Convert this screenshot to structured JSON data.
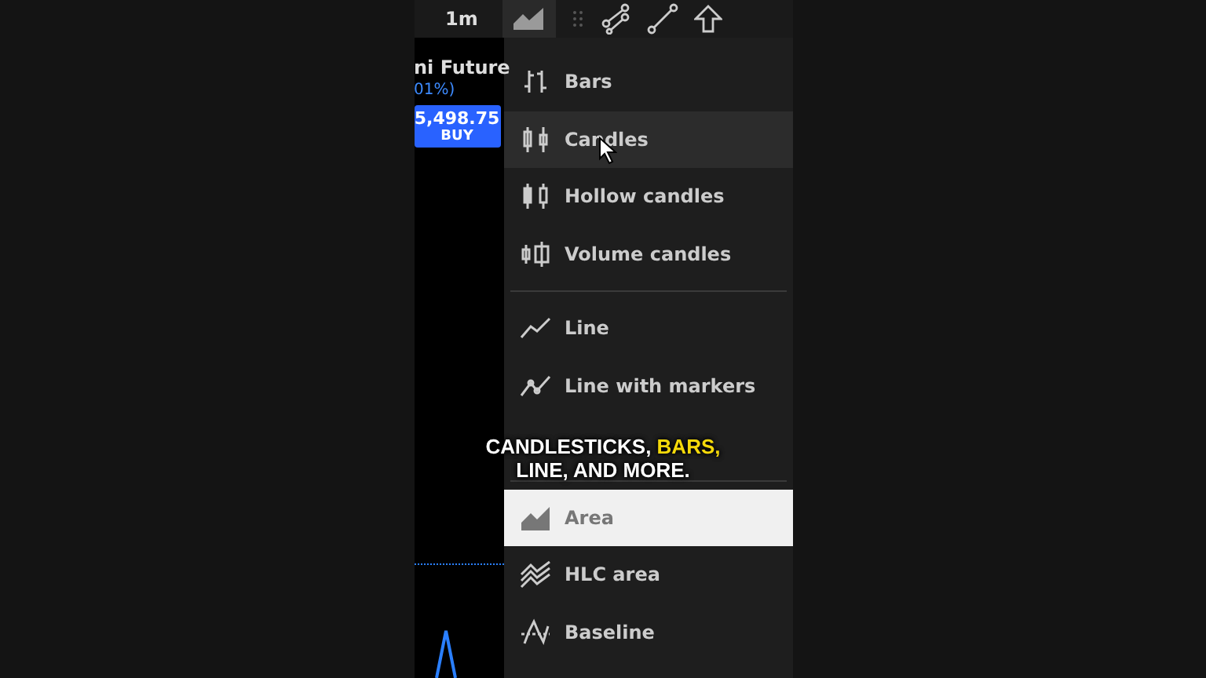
{
  "toolbar": {
    "interval": "1m"
  },
  "chart": {
    "symbol": "ni Future",
    "change": "01%)",
    "buy_price": "5,498.75",
    "buy_label": "BUY"
  },
  "menu": {
    "items": [
      {
        "kind": "bars",
        "label": "Bars",
        "selected": false,
        "hovered": false
      },
      {
        "kind": "candles",
        "label": "Candles",
        "selected": false,
        "hovered": true
      },
      {
        "kind": "hollow",
        "label": "Hollow candles",
        "selected": false,
        "hovered": false
      },
      {
        "kind": "volume",
        "label": "Volume candles",
        "selected": false,
        "hovered": false
      },
      {
        "kind": "divider"
      },
      {
        "kind": "line",
        "label": "Line",
        "selected": false,
        "hovered": false
      },
      {
        "kind": "markers",
        "label": "Line with markers",
        "selected": false,
        "hovered": false
      },
      {
        "kind": "step"
      },
      {
        "kind": "divider"
      },
      {
        "kind": "area",
        "label": "Area",
        "selected": true,
        "hovered": false
      },
      {
        "kind": "hlc",
        "label": "HLC area",
        "selected": false,
        "hovered": false
      },
      {
        "kind": "baseline",
        "label": "Baseline",
        "selected": false,
        "hovered": false
      }
    ]
  },
  "caption": "CANDLESTICKS, **BARS,** LINE, AND MORE."
}
